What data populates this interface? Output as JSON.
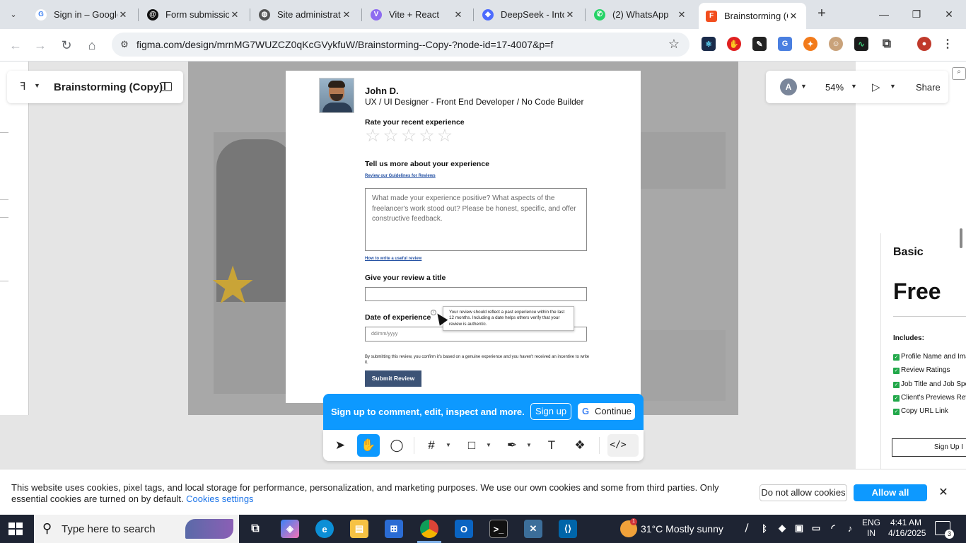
{
  "browser": {
    "tabs": [
      {
        "title": "Sign in – Google",
        "favicon": "google-icon",
        "color": "#4285f4"
      },
      {
        "title": "Form submission",
        "favicon": "threads-icon",
        "color": "#111111"
      },
      {
        "title": "Site administrati",
        "favicon": "globe-icon",
        "color": "#555555"
      },
      {
        "title": "Vite + React",
        "favicon": "vite-icon",
        "color": "#8e6cf0"
      },
      {
        "title": "DeepSeek - Into",
        "favicon": "deepseek-icon",
        "color": "#4d6bfe"
      },
      {
        "title": "(2) WhatsApp",
        "favicon": "whatsapp-icon",
        "color": "#25d366"
      },
      {
        "title": "Brainstorming (C",
        "favicon": "figma-icon",
        "color": "#f24e1e"
      }
    ],
    "url": "figma.com/design/mrnMG7WUZCZ0qKcGVykfuW/Brainstorming--Copy-?node-id=17-4007&p=f"
  },
  "figma": {
    "file_title": "Brainstorming (Copy)",
    "avatar_initial": "A",
    "zoom": "54%",
    "share_label": "Share",
    "signup_message": "Sign up to comment, edit, inspect and more.",
    "signup_label": "Sign up",
    "continue_label": "Continue"
  },
  "review_form": {
    "name": "John D.",
    "role": "UX / UI Designer - Front End Developer / No Code Builder",
    "rate_heading": "Rate your recent experience",
    "stars_filled": 0,
    "stars_total": 5,
    "tell_heading": "Tell us more about your experience",
    "guidelines_link": "Review our Guidelines for Reviews",
    "textarea_placeholder": "What made your experience positive? What aspects of the freelancer's work stood out? Please be honest, specific, and offer constructive feedback.",
    "useful_link": "How to write a useful review",
    "title_heading": "Give your review a title",
    "title_value": "",
    "date_heading": "Date of experience",
    "date_placeholder": "dd/mm/yyyy",
    "tooltip": "Your review should reflect a past experience within the last 12 months. Including a date helps others verify that your review is authentic.",
    "consent": "By submitting this review, you confirm it's based on a genuine experience and you haven't received an incentive to write it.",
    "submit_label": "Submit Review"
  },
  "pricing": {
    "plan": "Basic",
    "price": "Free",
    "includes": "Includes:",
    "features": [
      "Profile Name and Ima",
      "Review Ratings",
      "Job Title and Job Spe",
      "Client's Previews Revi",
      "Copy URL Link"
    ],
    "cta": "Sign Up I"
  },
  "cookie": {
    "text": "This website uses cookies, pixel tags, and local storage for performance, personalization, and marketing purposes. We use our own cookies and some from third parties. Only essential cookies are turned on by default.",
    "settings_link": "Cookies settings",
    "deny_label": "Do not allow cookies",
    "allow_label": "Allow all cookies"
  },
  "taskbar": {
    "search_placeholder": "Type here to search",
    "weather_badge": "1",
    "weather": "31°C  Mostly sunny",
    "lang1": "ENG",
    "lang2": "IN",
    "time": "4:41 AM",
    "date": "4/16/2025",
    "notifications": "3"
  },
  "colors": {
    "figma_blue": "#0d99ff",
    "submit_bg": "#3c5376",
    "taskbar": "#1e2433"
  }
}
